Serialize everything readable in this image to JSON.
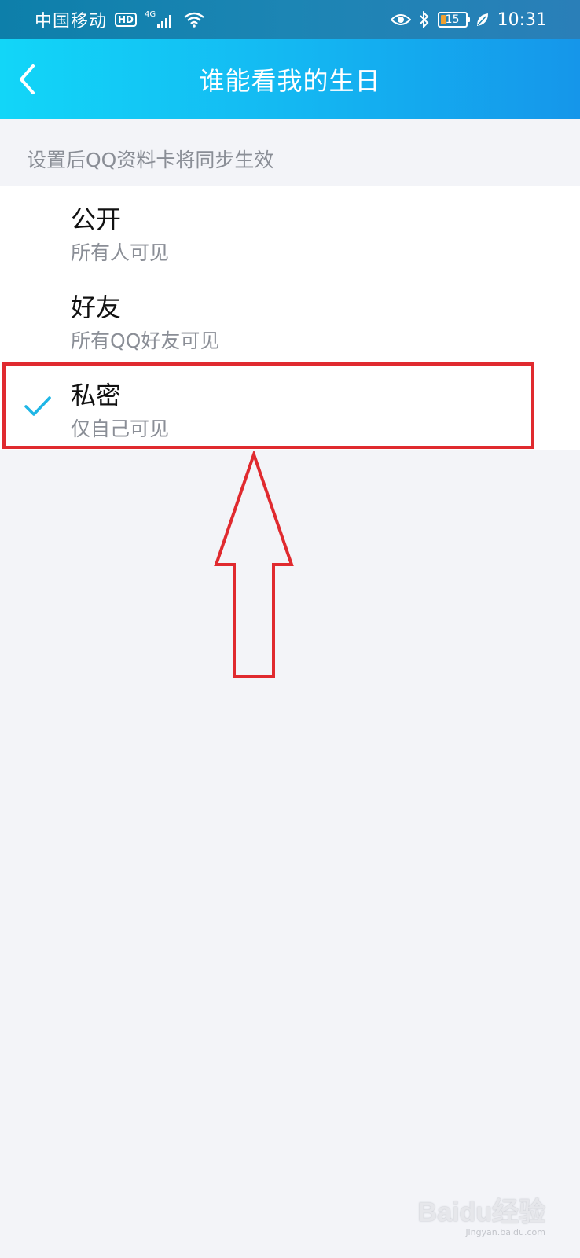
{
  "status_bar": {
    "carrier": "中国移动",
    "hd_badge": "HD",
    "network": "4G",
    "battery": "15",
    "time": "10:31",
    "icons": [
      "signal-icon",
      "wifi-icon",
      "eye-icon",
      "bluetooth-icon",
      "battery-icon",
      "leaf-icon"
    ]
  },
  "nav": {
    "title": "谁能看我的生日",
    "back_icon": "chevron-left-icon"
  },
  "hint": "设置后QQ资料卡将同步生效",
  "options": [
    {
      "title": "公开",
      "desc": "所有人可见",
      "selected": false
    },
    {
      "title": "好友",
      "desc": "所有QQ好友可见",
      "selected": false
    },
    {
      "title": "私密",
      "desc": "仅自己可见",
      "selected": true
    }
  ],
  "colors": {
    "accent": "#1fb6e6",
    "annotation_red": "#e02a2f",
    "nav_start": "#12d6f8",
    "nav_end": "#1596ea"
  },
  "watermark": {
    "text": "Baidu经验",
    "sub": "jingyan.baidu.com"
  }
}
